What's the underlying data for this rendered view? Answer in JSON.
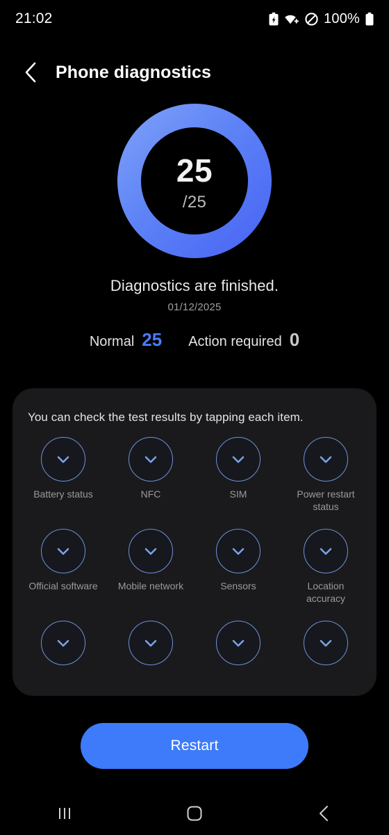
{
  "statusbar": {
    "time": "21:02",
    "battery_percent": "100%",
    "icons": [
      "battery-saver-icon",
      "wifi-icon",
      "do-not-disturb-icon",
      "battery-icon"
    ]
  },
  "header": {
    "back_icon": "chevron-left-icon",
    "title": "Phone diagnostics"
  },
  "gauge": {
    "score": "25",
    "total": "/25",
    "ring_color_start": "#6e95f7",
    "ring_color_end": "#4a67f4",
    "progress_percent": 100
  },
  "summary": {
    "status_text": "Diagnostics are finished.",
    "date": "01/12/2025"
  },
  "counts": {
    "normal_label": "Normal",
    "normal_value": "25",
    "normal_color": "#4b7bf5",
    "action_label": "Action required",
    "action_value": "0",
    "action_color": "#c9c9c9"
  },
  "card": {
    "hint": "You can check the test results by tapping each item.",
    "items": [
      {
        "label": "Battery status",
        "status_icon": "check-icon"
      },
      {
        "label": "NFC",
        "status_icon": "check-icon"
      },
      {
        "label": "SIM",
        "status_icon": "check-icon"
      },
      {
        "label": "Power restart status",
        "status_icon": "check-icon"
      },
      {
        "label": "Official software",
        "status_icon": "check-icon"
      },
      {
        "label": "Mobile network",
        "status_icon": "check-icon"
      },
      {
        "label": "Sensors",
        "status_icon": "check-icon"
      },
      {
        "label": "Location accuracy",
        "status_icon": "check-icon"
      },
      {
        "label": "",
        "status_icon": "check-icon"
      },
      {
        "label": "",
        "status_icon": "check-icon"
      },
      {
        "label": "",
        "status_icon": "check-icon"
      },
      {
        "label": "",
        "status_icon": "check-icon"
      }
    ]
  },
  "restart": {
    "label": "Restart",
    "color": "#3d7bfb"
  },
  "navbar": {
    "recents_icon": "recents-icon",
    "home_icon": "home-icon",
    "back_icon": "back-icon"
  }
}
